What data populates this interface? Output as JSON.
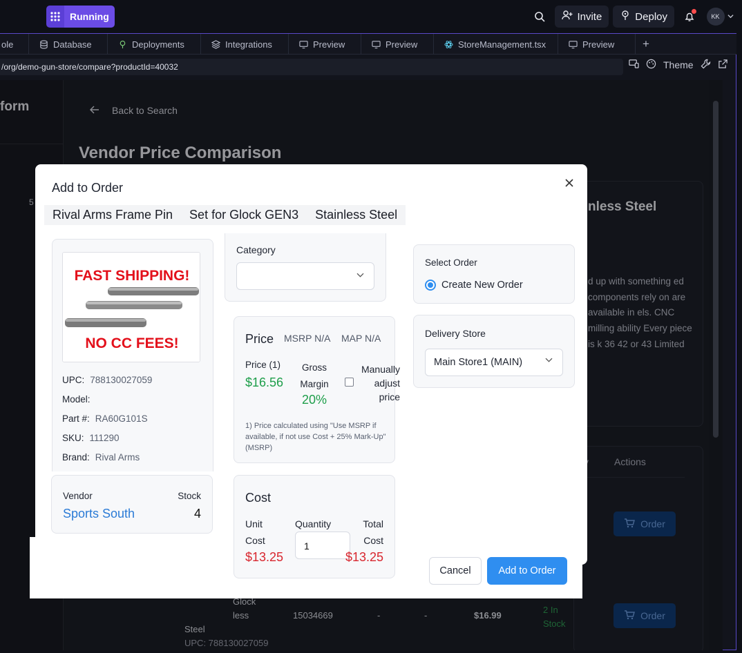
{
  "app": {
    "status_label": "Running",
    "invite_label": "Invite",
    "deploy_label": "Deploy",
    "avatar_initials": "KK"
  },
  "tabs": [
    {
      "label": "ole",
      "icon": "table-icon"
    },
    {
      "label": "Database",
      "icon": "database-icon"
    },
    {
      "label": "Deployments",
      "icon": "deploy-icon"
    },
    {
      "label": "Integrations",
      "icon": "layers-icon"
    },
    {
      "label": "Preview",
      "icon": "monitor-icon"
    },
    {
      "label": "Preview",
      "icon": "monitor-icon"
    },
    {
      "label": "StoreManagement.tsx",
      "icon": "react-icon"
    },
    {
      "label": "Preview",
      "icon": "monitor-icon"
    }
  ],
  "addressbar": {
    "url": "/org/demo-gun-store/compare?productId=40032",
    "theme_label": "Theme"
  },
  "page": {
    "sidebar_heading": "form",
    "sidebar_number": "5",
    "back_label": "Back to Search",
    "title": "Vendor Price Comparison",
    "card_title": "nless Steel",
    "card_description": "d up with something ed components rely on are available in els. CNC milling ability Every piece is k 36 42 or 43 Limited",
    "table_header": "Actions",
    "table_header_partial": "y",
    "order_label": "Order",
    "row2": {
      "name_line1": "Glock",
      "name_line2": "less",
      "name_line3": "Steel",
      "upc": "UPC: 788130027059",
      "part": "15034669",
      "dash1": "-",
      "dash2": "-",
      "price": "$16.99",
      "stock": "2 In Stock"
    }
  },
  "modal": {
    "title": "Add to Order",
    "product_name_parts": [
      "Rival Arms Frame Pin",
      "Set for Glock GEN3",
      "Stainless Steel"
    ],
    "image": {
      "line1": "FAST SHIPPING!",
      "line2": "NO CC FEES!"
    },
    "specs": {
      "upc_label": "UPC:",
      "upc": "788130027059",
      "model_label": "Model:",
      "model": "",
      "part_label": "Part #:",
      "part": "RA60G101S",
      "sku_label": "SKU:",
      "sku": "111290",
      "brand_label": "Brand:",
      "brand": "Rival Arms"
    },
    "vendor": {
      "label": "Vendor",
      "name": "Sports South",
      "stock_label": "Stock",
      "stock": "4"
    },
    "category": {
      "label": "Category",
      "value": ""
    },
    "price": {
      "heading": "Price",
      "msrp": "MSRP N/A",
      "map": "MAP N/A",
      "price_label": "Price (1)",
      "price_value": "$16.56",
      "margin_label": "Gross Margin",
      "margin_value": "20%",
      "manual_label": "Manually adjust price",
      "manual_checked": false,
      "note": "1) Price calculated using \"Use MSRP if available, if not use Cost + 25% Mark-Up\" (MSRP)"
    },
    "cost": {
      "heading": "Cost",
      "unit_label": "Unit Cost",
      "unit_value": "$13.25",
      "qty_label": "Quantity",
      "qty_value": "1",
      "total_label": "Total Cost",
      "total_value": "$13.25"
    },
    "select_order": {
      "label": "Select Order",
      "option": "Create New Order",
      "selected": true
    },
    "delivery": {
      "label": "Delivery Store",
      "value": "Main Store1 (MAIN)"
    },
    "cancel_label": "Cancel",
    "add_label": "Add to Order"
  },
  "colors": {
    "accent": "#2f8ef0",
    "positive": "#1e9e4a",
    "negative": "#d8262e",
    "brand": "#6b4ce6"
  }
}
